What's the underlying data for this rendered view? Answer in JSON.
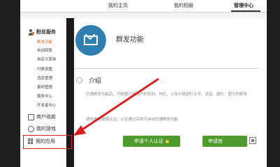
{
  "topnav": {
    "home": "我的主页",
    "album": "我的相册",
    "admin": "管理中心"
  },
  "sidebar": {
    "fans_service": {
      "title": "粉丝服务",
      "items": [
        "群发功能",
        "自动回复",
        "自定义菜单",
        "付费设置",
        "消息管理",
        "素材管理",
        "服务中心",
        "开发者中心"
      ]
    },
    "merchant": "商户收款",
    "games": "我的游戏",
    "apps": "我的应用"
  },
  "main": {
    "title": "群发功能",
    "intro_title": "介绍",
    "intro_text": "开通群发功能后，可根据订阅用户的性别、地区、以及分组进行文字、语音、图片、图文的群发",
    "notice": "请先申请微博认证，认证通过后即可自动开通群发功能",
    "btn_personal": "申请个人认证",
    "btn_enterprise": "申请官"
  },
  "colors": {
    "accent_orange": "#e0651c",
    "button_green": "#4e9a2b",
    "icon_blue": "#2f7fb0",
    "highlight_red": "#d9201e"
  }
}
